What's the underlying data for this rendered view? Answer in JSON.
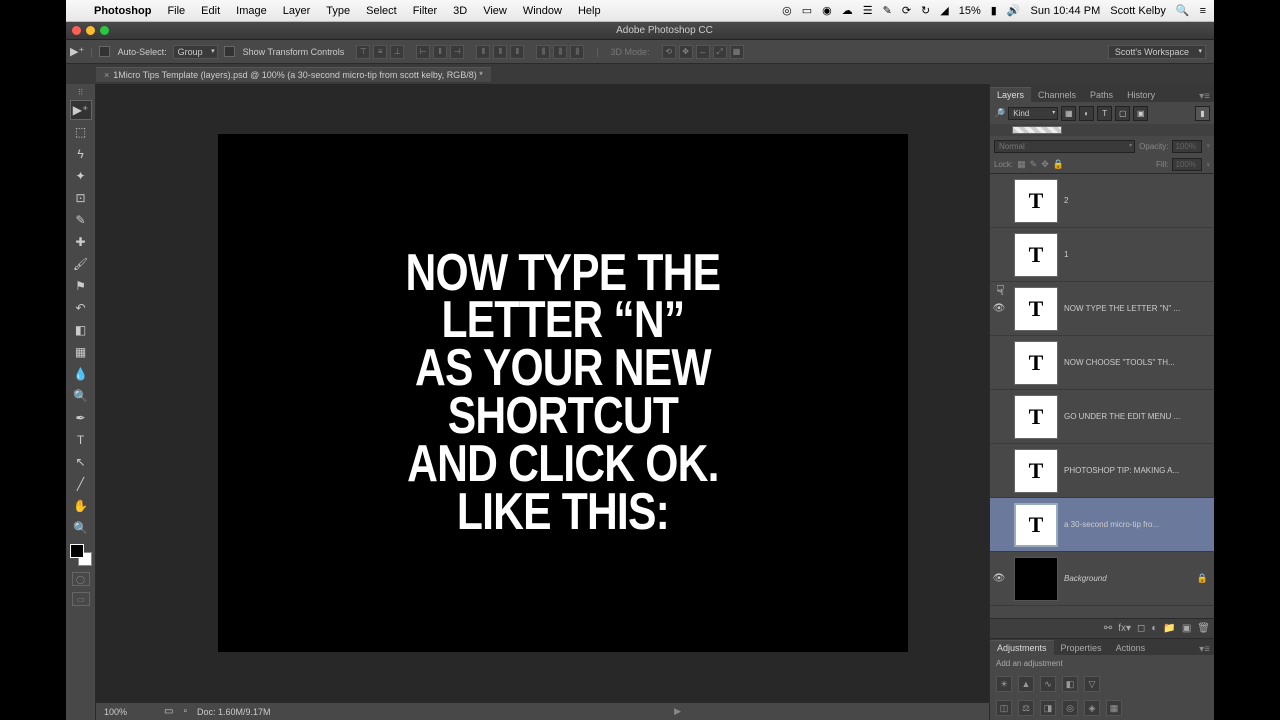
{
  "menubar": {
    "app_name": "Photoshop",
    "menus": [
      "File",
      "Edit",
      "Image",
      "Layer",
      "Type",
      "Select",
      "Filter",
      "3D",
      "View",
      "Window",
      "Help"
    ],
    "battery": "15%",
    "clock": "Sun 10:44 PM",
    "user": "Scott Kelby"
  },
  "window": {
    "title": "Adobe Photoshop CC"
  },
  "options": {
    "auto_select": "Auto-Select:",
    "auto_select_type": "Group",
    "show_transform": "Show Transform Controls",
    "mode_3d": "3D Mode:",
    "workspace": "Scott's Workspace"
  },
  "doc_tab": {
    "label": "1Micro Tips Template (layers).psd @ 100% (a 30-second micro-tip from scott kelby, RGB/8) *"
  },
  "canvas": {
    "text": "NOW TYPE THE\nLETTER “N”\nAS YOUR NEW\nSHORTCUT\nAND CLICK OK.\nLIKE THIS:"
  },
  "status": {
    "zoom": "100%",
    "doc_info": "Doc: 1.60M/9.17M"
  },
  "panels": {
    "layers_tabs": [
      "Layers",
      "Channels",
      "Paths",
      "History"
    ],
    "filter_label": "Kind",
    "blend_mode": "Normal",
    "opacity_label": "Opacity:",
    "opacity_value": "100%",
    "lock_label": "Lock:",
    "fill_label": "Fill:",
    "fill_value": "100%",
    "layers": [
      {
        "name": "2",
        "vis": false,
        "type": "T"
      },
      {
        "name": "1",
        "vis": false,
        "type": "T"
      },
      {
        "name": "NOW TYPE THE LETTER \"N\" ...",
        "vis": true,
        "type": "T"
      },
      {
        "name": "NOW CHOOSE \"TOOLS\"  TH...",
        "vis": false,
        "type": "T"
      },
      {
        "name": "GO UNDER THE EDIT MENU ...",
        "vis": false,
        "type": "T"
      },
      {
        "name": "PHOTOSHOP TIP: MAKING A...",
        "vis": false,
        "type": "T"
      },
      {
        "name": "a 30-second micro-tip fro...",
        "vis": false,
        "type": "T",
        "selected": true
      },
      {
        "name": "Background",
        "vis": true,
        "type": "bg",
        "locked": true
      }
    ],
    "adj_tabs": [
      "Adjustments",
      "Properties",
      "Actions"
    ],
    "adj_label": "Add an adjustment"
  }
}
